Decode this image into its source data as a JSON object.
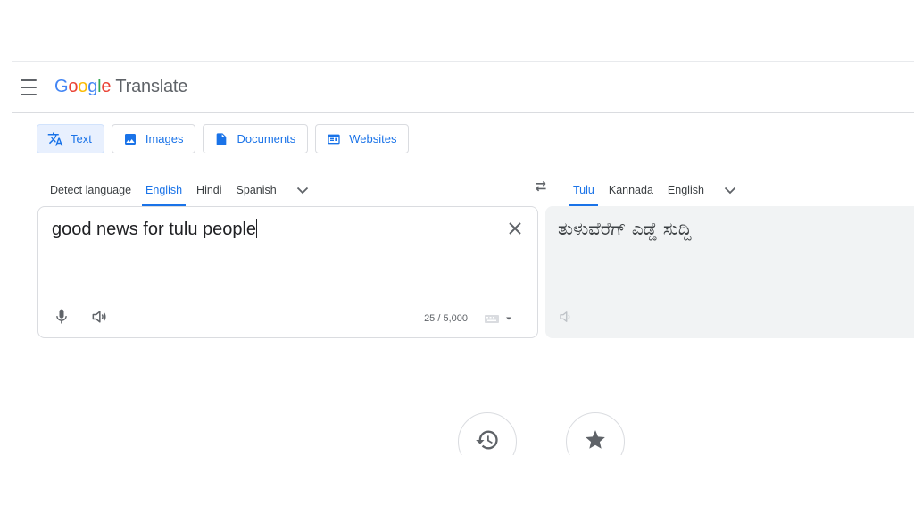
{
  "app": {
    "logo_letters": [
      "G",
      "o",
      "o",
      "g",
      "l",
      "e"
    ],
    "product": "Translate"
  },
  "modes": [
    {
      "label": "Text",
      "icon": "translate-icon"
    },
    {
      "label": "Images",
      "icon": "image-icon"
    },
    {
      "label": "Documents",
      "icon": "document-icon"
    },
    {
      "label": "Websites",
      "icon": "website-icon"
    }
  ],
  "source_languages": [
    "Detect language",
    "English",
    "Hindi",
    "Spanish"
  ],
  "source_selected": "English",
  "target_languages": [
    "Tulu",
    "Kannada",
    "English"
  ],
  "target_selected": "Tulu",
  "source": {
    "text": "good news for tulu people",
    "char_count": "25 / 5,000"
  },
  "target": {
    "text": "ತುಳುವೆರೆಗ್ ಎಡ್ಡೆ ಸುದ್ದಿ"
  },
  "colors": {
    "accent": "#1a73e8",
    "active_mode_bg": "#e8f0fe",
    "target_panel_bg": "#f1f3f4"
  }
}
